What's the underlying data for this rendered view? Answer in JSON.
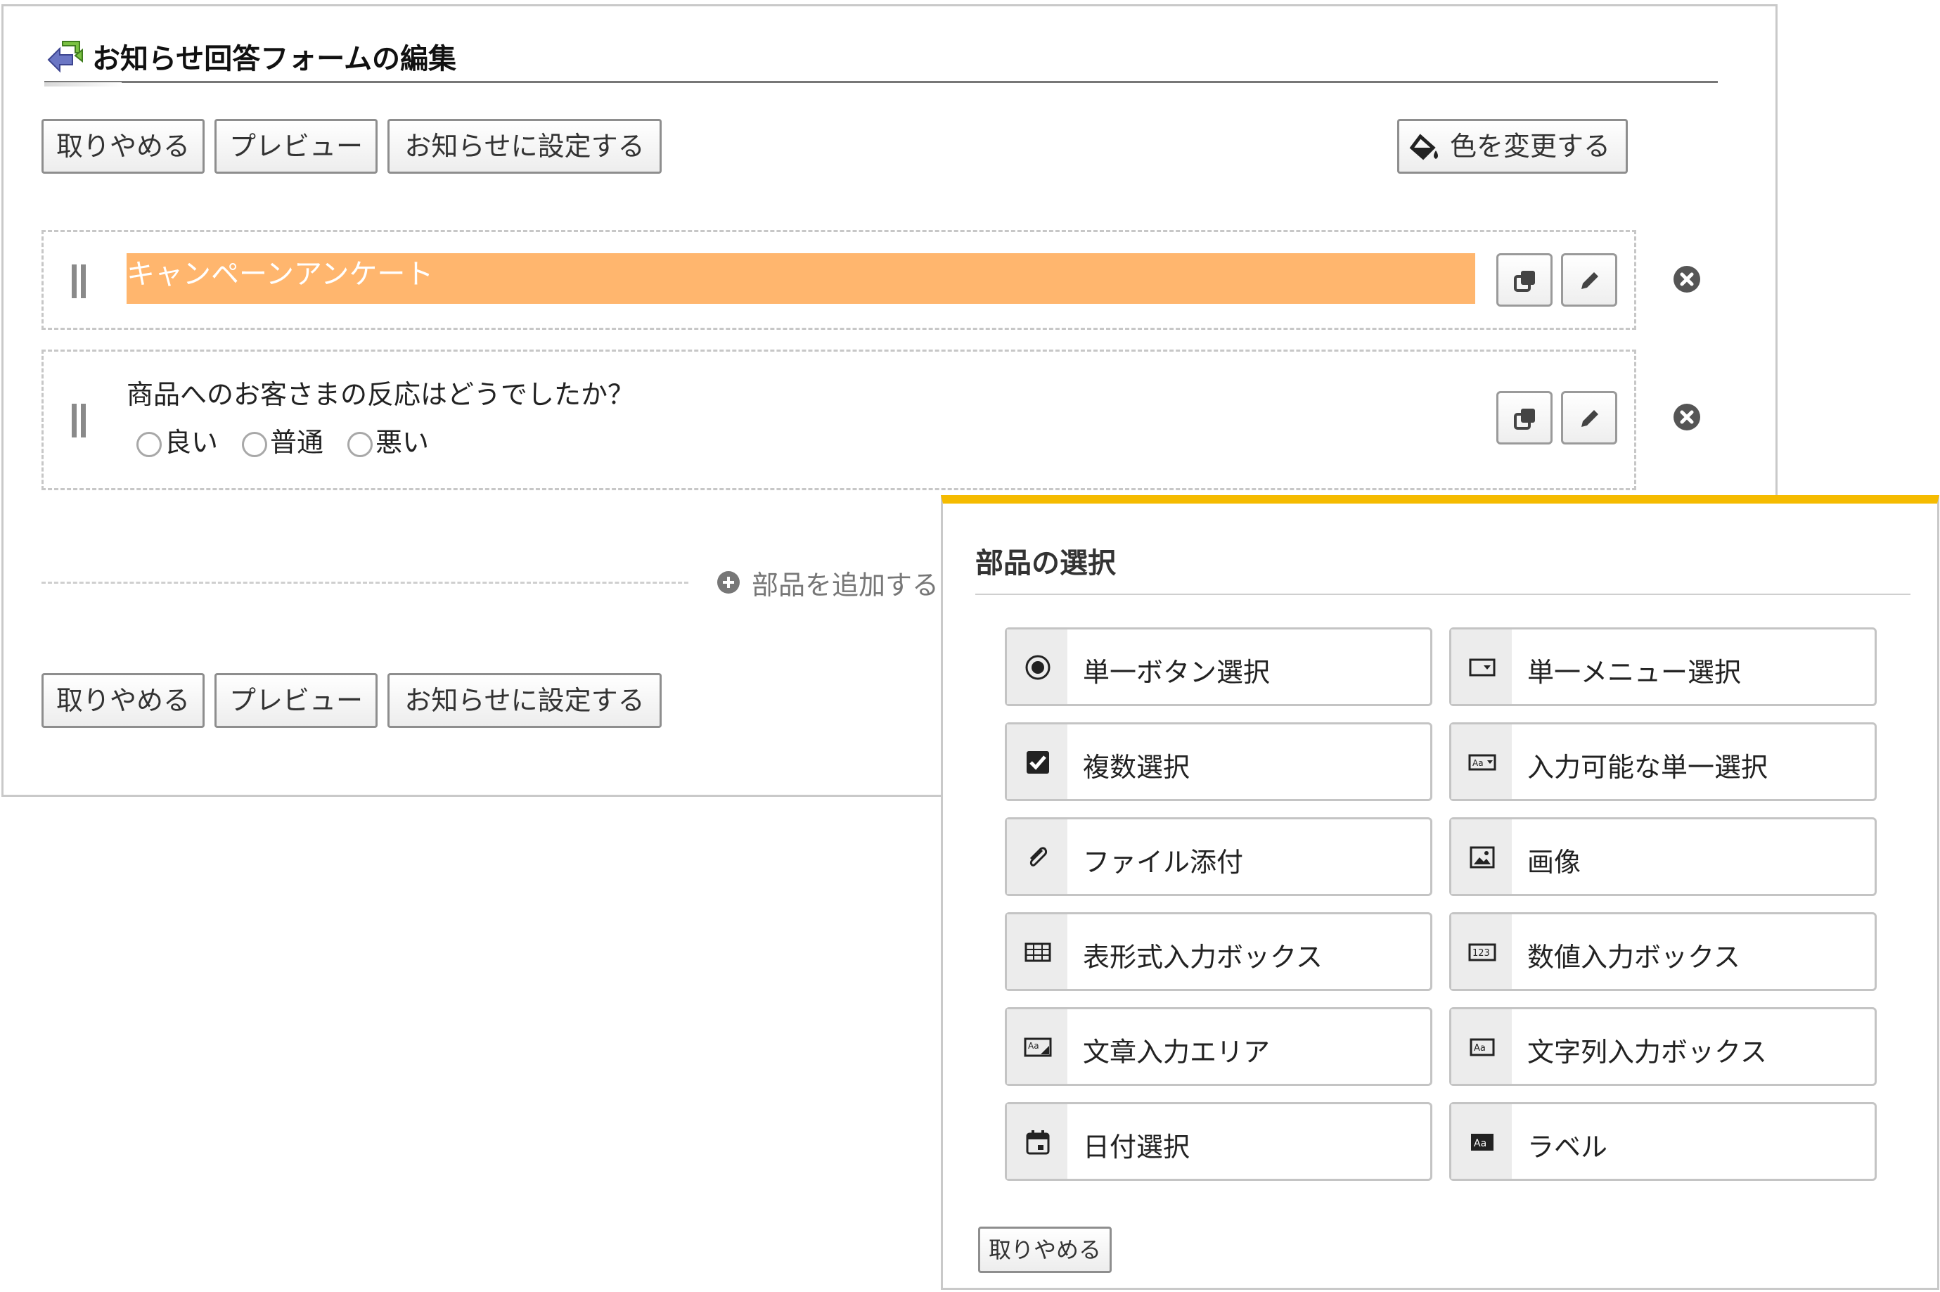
{
  "editor": {
    "title": "お知らせ回答フォームの編集",
    "toolbar_top": {
      "cancel": "取りやめる",
      "preview": "プレビュー",
      "set_notice": "お知らせに設定する",
      "change_color": "色を変更する"
    },
    "parts": [
      {
        "type": "label",
        "text": "キャンペーンアンケート"
      },
      {
        "type": "single-radio",
        "question": "商品へのお客さまの反応はどうでしたか？",
        "options": [
          "良い",
          "普通",
          "悪い"
        ]
      }
    ],
    "add_part": "部品を追加する",
    "toolbar_bottom": {
      "cancel": "取りやめる",
      "preview": "プレビュー",
      "set_notice": "お知らせに設定する"
    }
  },
  "dialog": {
    "title": "部品の選択",
    "options": [
      {
        "label": "単一ボタン選択",
        "icon": "radio-icon"
      },
      {
        "label": "単一メニュー選択",
        "icon": "dropdown-icon"
      },
      {
        "label": "複数選択",
        "icon": "checkbox-icon"
      },
      {
        "label": "入力可能な単一選択",
        "icon": "editable-select-icon"
      },
      {
        "label": "ファイル添付",
        "icon": "paperclip-icon"
      },
      {
        "label": "画像",
        "icon": "image-icon"
      },
      {
        "label": "表形式入力ボックス",
        "icon": "table-icon"
      },
      {
        "label": "数値入力ボックス",
        "icon": "number-icon"
      },
      {
        "label": "文章入力エリア",
        "icon": "textarea-icon"
      },
      {
        "label": "文字列入力ボックス",
        "icon": "textbox-icon"
      },
      {
        "label": "日付選択",
        "icon": "calendar-icon"
      },
      {
        "label": "ラベル",
        "icon": "label-icon"
      }
    ],
    "cancel": "取りやめる"
  },
  "colors": {
    "banner": "#ffb66e",
    "dialog_accent": "#f5bb00"
  }
}
